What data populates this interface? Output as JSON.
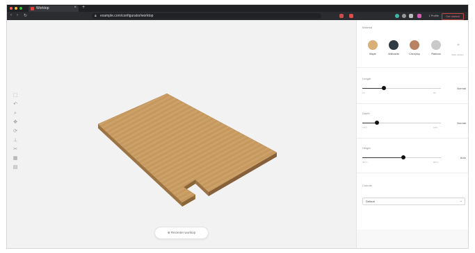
{
  "browser": {
    "tab_title": "Worktop",
    "tab_close": "×",
    "new_tab": "+",
    "url_host": "example.com/configurator/worktop",
    "nav_back": "‹",
    "nav_forward": "›",
    "nav_reload": "↻",
    "account_label": "1 Profile",
    "action_button": "Get started",
    "traffic_colors": [
      "#ff5f57",
      "#febc2e",
      "#28c840"
    ]
  },
  "toolbar": {
    "tools": [
      "pointer-icon",
      "undo-icon",
      "zoom-icon",
      "move-icon",
      "rotate-icon",
      "measure-icon",
      "cut-icon",
      "layers-icon",
      "grid-icon"
    ],
    "glyphs": [
      "⬚",
      "↶",
      "⌕",
      "✥",
      "⟳",
      "⊥",
      "✂",
      "▦",
      "▤"
    ]
  },
  "canvas": {
    "reset_label": "⊕ Recenter worktop",
    "worktop_color": "#c49a63"
  },
  "panel": {
    "material_title": "Material",
    "materials": [
      {
        "label": "Maple",
        "color": "#d9b07a"
      },
      {
        "label": "Anthracite",
        "color": "#2e3b45"
      },
      {
        "label": "Cherrytop",
        "color": "#b98262"
      },
      {
        "label": "Platinum",
        "color": "#c9c9c9"
      }
    ],
    "more_label": "More options",
    "more_glyph": "+",
    "sliders": [
      {
        "title": "Length",
        "min": "1m",
        "max": "3m",
        "value_label": "Normal",
        "value": 0.27
      },
      {
        "title": "Depth",
        "min": "0.5m",
        "max": "0.8m",
        "value_label": "Normal",
        "value": 0.19
      },
      {
        "title": "Height",
        "min": "60cm",
        "max": "90cm",
        "value_label": "Auto",
        "value": 0.52
      }
    ],
    "edge_title": "Cutouts",
    "edge_value": "Default",
    "edge_chevron": "⌄"
  }
}
